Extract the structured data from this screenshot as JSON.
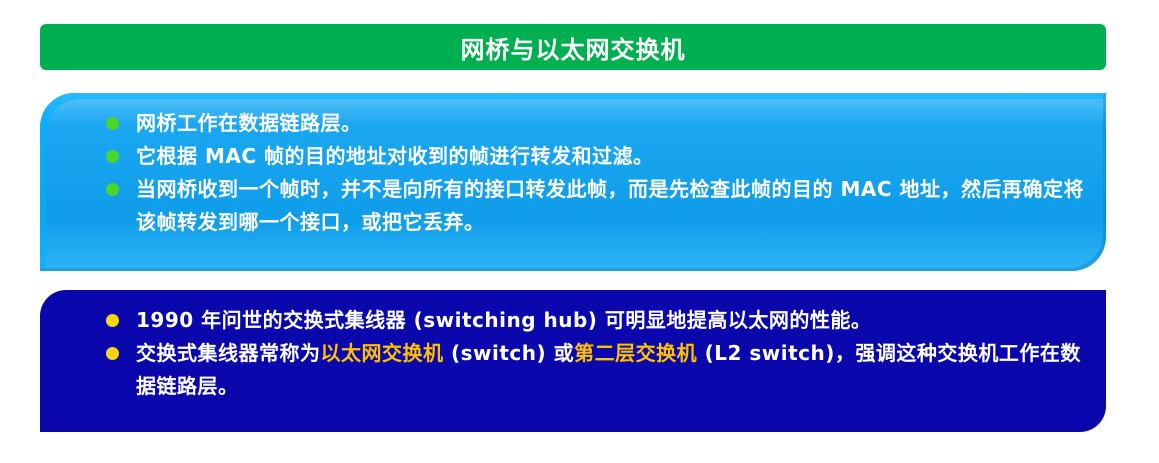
{
  "title": "网桥与以太网交换机",
  "colors": {
    "title_bg": "#00b050",
    "blue_box": "#1aa7f2",
    "navy_box": "#0a07ad",
    "green_bullet": "#4ad52c",
    "yellow_bullet": "#f5d60f",
    "highlight": "#ffc000"
  },
  "box1": {
    "items": [
      "网桥工作在数据链路层。",
      "它根据 MAC 帧的目的地址对收到的帧进行转发和过滤。",
      "当网桥收到一个帧时，并不是向所有的接口转发此帧，而是先检查此帧的目的 MAC 地址，然后再确定将该帧转发到哪一个接口，或把它丢弃。"
    ]
  },
  "box2": {
    "item1": "1990 年问世的交换式集线器 (switching hub) 可明显地提高以太网的性能。",
    "item2": {
      "part1": "交换式集线器常称为",
      "highlight1": "以太网交换机",
      "part2": " (switch) 或",
      "highlight2": "第二层交换机",
      "part3": " (L2 switch)，强调这种交换机工作在数据链路层。"
    }
  }
}
